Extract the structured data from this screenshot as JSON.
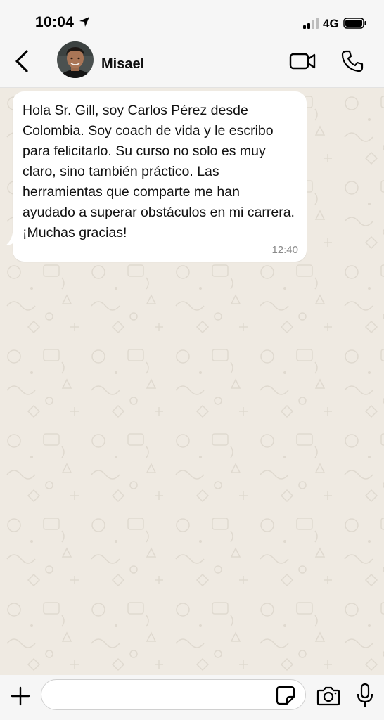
{
  "status_bar": {
    "time": "10:04",
    "network": "4G",
    "icons": [
      "location-arrow-icon",
      "signal-icon",
      "battery-icon"
    ]
  },
  "header": {
    "contact_name": "Misael",
    "icons": [
      "back-chevron-icon",
      "avatar",
      "video-call-icon",
      "phone-call-icon"
    ]
  },
  "messages": [
    {
      "text": "Hola Sr. Gill, soy Carlos Pérez desde Colombia. Soy coach de vida y le escribo para felicitarlo. Su curso no solo es muy claro, sino también práctico. Las herramientas que comparte me han ayudado a superar obstáculos en mi carrera. ¡Muchas gracias!",
      "time": "12:40",
      "direction": "incoming"
    }
  ],
  "composer": {
    "input_value": "",
    "icons": [
      "plus-icon",
      "sticker-icon",
      "camera-icon",
      "microphone-icon"
    ]
  },
  "colors": {
    "chat_background": "#efeae2",
    "bubble": "#ffffff",
    "bar_background": "#f6f6f6",
    "timestamp": "#8a8a8a"
  }
}
